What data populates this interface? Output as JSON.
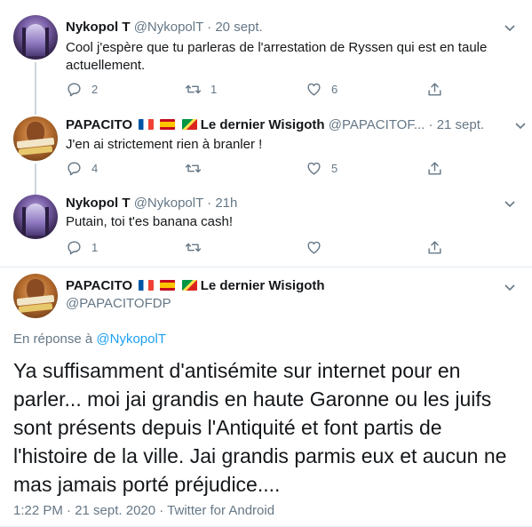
{
  "tweets": [
    {
      "display_name": "Nykopol T",
      "handle": "@NykopolT",
      "separator": "·",
      "time": "20 sept.",
      "text": "Cool j'espère que tu parleras de l'arrestation de Ryssen qui est en taule actuellement.",
      "replies": "2",
      "retweets": "1",
      "likes": "6"
    },
    {
      "display_name": "PAPACITO",
      "suffix": "Le dernier Wisigoth",
      "handle": "@PAPACITOF...",
      "separator": "·",
      "time": "21 sept.",
      "text": "J'en ai strictement rien à branler !",
      "replies": "4",
      "retweets": "",
      "likes": "5"
    },
    {
      "display_name": "Nykopol T",
      "handle": "@NykopolT",
      "separator": "·",
      "time": "21h",
      "text": "Putain, toi t'es banana cash!",
      "replies": "1",
      "retweets": "",
      "likes": ""
    }
  ],
  "focus": {
    "display_name": "PAPACITO",
    "suffix": "Le dernier Wisigoth",
    "handle": "@PAPACITOFDP",
    "reply_prefix": "En réponse à",
    "reply_to": "@NykopolT",
    "text": "Ya suffisamment d'antisémite sur internet pour en parler... moi jai grandis en haute Garonne ou les juifs sont présents depuis l'Antiquité et font partis de l'histoire de la ville. Jai grandis parmis eux et aucun ne mas jamais porté préjudice....",
    "meta": "1:22 PM · 21 sept. 2020 · Twitter for Android"
  },
  "icons": {
    "reply": "reply-icon",
    "retweet": "retweet-icon",
    "like": "heart-icon",
    "share": "share-icon",
    "more": "chevron-down-icon",
    "flags": [
      "flag-france-icon",
      "flag-spain-icon",
      "flag-congo-icon"
    ]
  },
  "colors": {
    "text": "#14171a",
    "secondary": "#657786",
    "link": "#1da1f2",
    "thread_line": "#ccd6dd",
    "divider": "#e6ecf0"
  }
}
